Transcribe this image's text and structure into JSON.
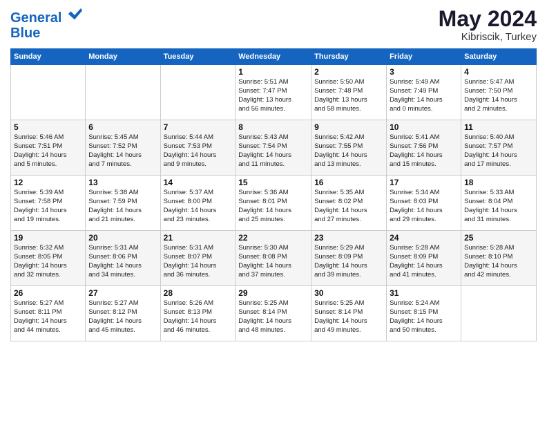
{
  "logo": {
    "line1": "General",
    "line2": "Blue"
  },
  "title": "May 2024",
  "location": "Kibriscik, Turkey",
  "weekdays": [
    "Sunday",
    "Monday",
    "Tuesday",
    "Wednesday",
    "Thursday",
    "Friday",
    "Saturday"
  ],
  "weeks": [
    [
      {
        "day": "",
        "info": ""
      },
      {
        "day": "",
        "info": ""
      },
      {
        "day": "",
        "info": ""
      },
      {
        "day": "1",
        "info": "Sunrise: 5:51 AM\nSunset: 7:47 PM\nDaylight: 13 hours\nand 56 minutes."
      },
      {
        "day": "2",
        "info": "Sunrise: 5:50 AM\nSunset: 7:48 PM\nDaylight: 13 hours\nand 58 minutes."
      },
      {
        "day": "3",
        "info": "Sunrise: 5:49 AM\nSunset: 7:49 PM\nDaylight: 14 hours\nand 0 minutes."
      },
      {
        "day": "4",
        "info": "Sunrise: 5:47 AM\nSunset: 7:50 PM\nDaylight: 14 hours\nand 2 minutes."
      }
    ],
    [
      {
        "day": "5",
        "info": "Sunrise: 5:46 AM\nSunset: 7:51 PM\nDaylight: 14 hours\nand 5 minutes."
      },
      {
        "day": "6",
        "info": "Sunrise: 5:45 AM\nSunset: 7:52 PM\nDaylight: 14 hours\nand 7 minutes."
      },
      {
        "day": "7",
        "info": "Sunrise: 5:44 AM\nSunset: 7:53 PM\nDaylight: 14 hours\nand 9 minutes."
      },
      {
        "day": "8",
        "info": "Sunrise: 5:43 AM\nSunset: 7:54 PM\nDaylight: 14 hours\nand 11 minutes."
      },
      {
        "day": "9",
        "info": "Sunrise: 5:42 AM\nSunset: 7:55 PM\nDaylight: 14 hours\nand 13 minutes."
      },
      {
        "day": "10",
        "info": "Sunrise: 5:41 AM\nSunset: 7:56 PM\nDaylight: 14 hours\nand 15 minutes."
      },
      {
        "day": "11",
        "info": "Sunrise: 5:40 AM\nSunset: 7:57 PM\nDaylight: 14 hours\nand 17 minutes."
      }
    ],
    [
      {
        "day": "12",
        "info": "Sunrise: 5:39 AM\nSunset: 7:58 PM\nDaylight: 14 hours\nand 19 minutes."
      },
      {
        "day": "13",
        "info": "Sunrise: 5:38 AM\nSunset: 7:59 PM\nDaylight: 14 hours\nand 21 minutes."
      },
      {
        "day": "14",
        "info": "Sunrise: 5:37 AM\nSunset: 8:00 PM\nDaylight: 14 hours\nand 23 minutes."
      },
      {
        "day": "15",
        "info": "Sunrise: 5:36 AM\nSunset: 8:01 PM\nDaylight: 14 hours\nand 25 minutes."
      },
      {
        "day": "16",
        "info": "Sunrise: 5:35 AM\nSunset: 8:02 PM\nDaylight: 14 hours\nand 27 minutes."
      },
      {
        "day": "17",
        "info": "Sunrise: 5:34 AM\nSunset: 8:03 PM\nDaylight: 14 hours\nand 29 minutes."
      },
      {
        "day": "18",
        "info": "Sunrise: 5:33 AM\nSunset: 8:04 PM\nDaylight: 14 hours\nand 31 minutes."
      }
    ],
    [
      {
        "day": "19",
        "info": "Sunrise: 5:32 AM\nSunset: 8:05 PM\nDaylight: 14 hours\nand 32 minutes."
      },
      {
        "day": "20",
        "info": "Sunrise: 5:31 AM\nSunset: 8:06 PM\nDaylight: 14 hours\nand 34 minutes."
      },
      {
        "day": "21",
        "info": "Sunrise: 5:31 AM\nSunset: 8:07 PM\nDaylight: 14 hours\nand 36 minutes."
      },
      {
        "day": "22",
        "info": "Sunrise: 5:30 AM\nSunset: 8:08 PM\nDaylight: 14 hours\nand 37 minutes."
      },
      {
        "day": "23",
        "info": "Sunrise: 5:29 AM\nSunset: 8:09 PM\nDaylight: 14 hours\nand 39 minutes."
      },
      {
        "day": "24",
        "info": "Sunrise: 5:28 AM\nSunset: 8:09 PM\nDaylight: 14 hours\nand 41 minutes."
      },
      {
        "day": "25",
        "info": "Sunrise: 5:28 AM\nSunset: 8:10 PM\nDaylight: 14 hours\nand 42 minutes."
      }
    ],
    [
      {
        "day": "26",
        "info": "Sunrise: 5:27 AM\nSunset: 8:11 PM\nDaylight: 14 hours\nand 44 minutes."
      },
      {
        "day": "27",
        "info": "Sunrise: 5:27 AM\nSunset: 8:12 PM\nDaylight: 14 hours\nand 45 minutes."
      },
      {
        "day": "28",
        "info": "Sunrise: 5:26 AM\nSunset: 8:13 PM\nDaylight: 14 hours\nand 46 minutes."
      },
      {
        "day": "29",
        "info": "Sunrise: 5:25 AM\nSunset: 8:14 PM\nDaylight: 14 hours\nand 48 minutes."
      },
      {
        "day": "30",
        "info": "Sunrise: 5:25 AM\nSunset: 8:14 PM\nDaylight: 14 hours\nand 49 minutes."
      },
      {
        "day": "31",
        "info": "Sunrise: 5:24 AM\nSunset: 8:15 PM\nDaylight: 14 hours\nand 50 minutes."
      },
      {
        "day": "",
        "info": ""
      }
    ]
  ]
}
